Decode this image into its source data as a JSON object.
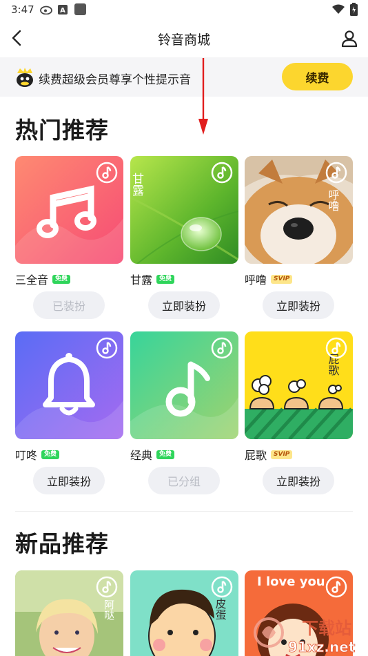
{
  "status_bar": {
    "time": "3:47"
  },
  "header": {
    "title": "铃音商城"
  },
  "vip_banner": {
    "text": "续费超级会员尊享个性提示音",
    "button": "续费"
  },
  "hot_section": {
    "title": "热门推荐",
    "items": [
      {
        "name": "三全音",
        "badge": "免费",
        "button": "已装扮"
      },
      {
        "name": "甘露",
        "badge": "免费",
        "button": "立即装扮",
        "cover_text": "甘露"
      },
      {
        "name": "呼噜",
        "badge": "SVIP",
        "button": "立即装扮",
        "cover_text": "呼噜"
      },
      {
        "name": "叮咚",
        "badge": "免费",
        "button": "立即装扮"
      },
      {
        "name": "经典",
        "badge": "免费",
        "button": "已分组"
      },
      {
        "name": "屁歌",
        "badge": "SVIP",
        "button": "立即装扮",
        "cover_text": "屁歌"
      }
    ]
  },
  "new_section": {
    "title": "新品推荐",
    "items": [
      {
        "cover_text": "阿哒"
      },
      {
        "cover_text": "皮蛋"
      },
      {
        "cover_text": "I love you"
      }
    ]
  },
  "watermark": {
    "text": "下载站",
    "url_text": "91xz.net"
  },
  "colors": {
    "accent_yellow": "#fcd62e",
    "free_badge": "#2fd55b",
    "svip_badge": "#fde68a",
    "button_bg": "#eff0f4"
  }
}
